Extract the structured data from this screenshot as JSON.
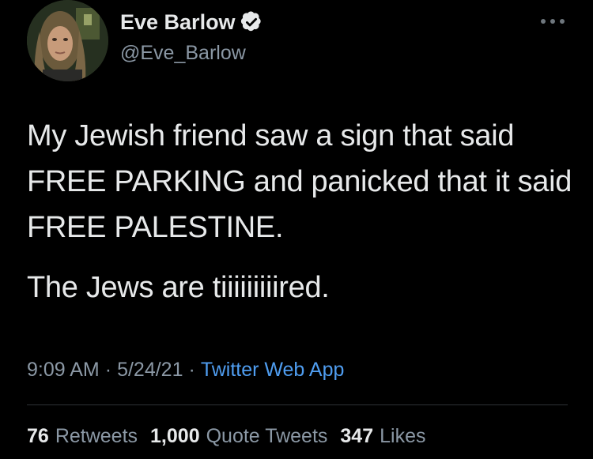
{
  "author": {
    "display_name": "Eve Barlow",
    "handle": "@Eve_Barlow",
    "verified": true,
    "verified_icon": "verified-badge-icon",
    "avatar_icon": "profile-photo"
  },
  "more_icon": "more-horizontal-icon",
  "tweet": {
    "paragraphs": [
      "My Jewish friend saw a sign that said FREE PARKING and panicked that it said FREE PALESTINE.",
      "The Jews are tiiiiiiiiired."
    ]
  },
  "meta": {
    "time": "9:09 AM",
    "sep1": "·",
    "date": "5/24/21",
    "sep2": "·",
    "source": "Twitter Web App"
  },
  "stats": {
    "retweets_count": "76",
    "retweets_label": "Retweets",
    "quotes_count": "1,000",
    "quotes_label": "Quote Tweets",
    "likes_count": "347",
    "likes_label": "Likes"
  },
  "colors": {
    "background": "#000000",
    "text_primary": "#e7e9ea",
    "text_secondary": "#8b98a5",
    "link": "#4f9df0",
    "divider": "#2f3336"
  }
}
